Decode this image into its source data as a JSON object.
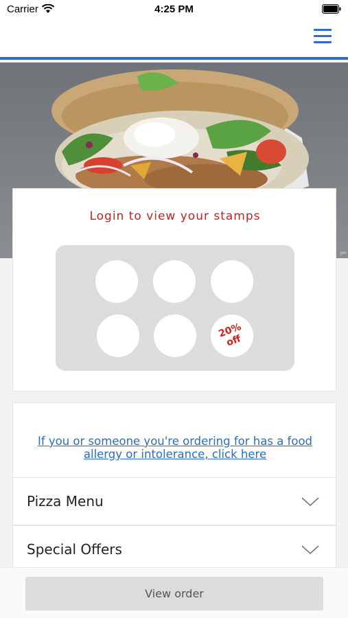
{
  "status_bar": {
    "carrier": "Carrier",
    "time": "4:25 PM",
    "wifi_icon": "wifi-icon",
    "battery_icon": "battery-icon"
  },
  "nav": {
    "menu_icon": "hamburger-menu-icon",
    "accent_color": "#2e6bc4"
  },
  "hero": {
    "image": "kebab-wrap-photo",
    "credit": "ges"
  },
  "stamps": {
    "title": "Login to view your stamps",
    "title_color": "#c81f1f",
    "total": 6,
    "reward": {
      "line1": "20%",
      "line2": "off"
    }
  },
  "allergy": {
    "link_text": "If you or someone you're ordering for has a food allergy or intolerance, click here",
    "link_color": "#2b6cc4"
  },
  "menu_sections": [
    {
      "label": "Pizza Menu",
      "icon": "chevron-down-icon"
    },
    {
      "label": "Special Offers",
      "icon": "chevron-down-icon"
    }
  ],
  "bottom": {
    "view_order_label": "View order"
  }
}
